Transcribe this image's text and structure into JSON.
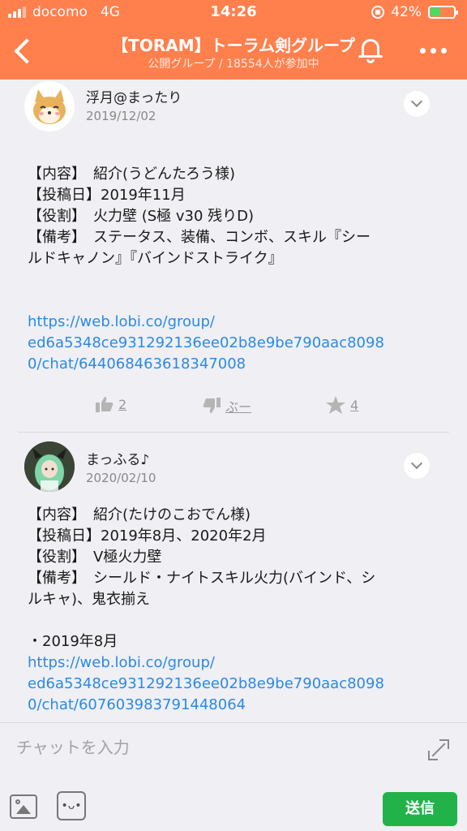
{
  "status_bar": {
    "carrier": "docomo",
    "network": "4G",
    "time": "14:26",
    "battery": "42%",
    "battery_level": 0.42
  },
  "header": {
    "title": "【TORAM】トーラム剣グループ",
    "subtitle": "公開グループ / 18554人が参加中",
    "icons": [
      "back-icon",
      "bell-icon",
      "more-icon"
    ]
  },
  "posts": [
    {
      "author": "浮月@まったり",
      "date": "2019/12/02",
      "lines": [
        "【内容】　紹介(うどんたろう様)",
        "【投稿日】2019年11月",
        "【役割】　火力壁 (S極 v30 残りD)",
        "【備考】　ステータス、装備、コンボ、スキル『シー",
        "ルドキャノン』『バインドストライク』"
      ],
      "link_lines": [
        "https://web.lobi.co/group/",
        "ed6a5348ce931292136ee02b8e9be790aac8098",
        "0/chat/644068463618347008"
      ],
      "likes": "2",
      "boo": "ぶー",
      "stars": "4"
    },
    {
      "author": "まっふる♪",
      "date": "2020/02/10",
      "lines": [
        "【内容】　紹介(たけのこおでん様)",
        "【投稿日】2019年8月、2020年2月",
        "【役割】　V極火力壁",
        "【備考】　シールド・ナイトスキル火力(バインド、シ",
        "ルキャ)、鬼衣揃え",
        "",
        "・2019年8月"
      ],
      "link_lines": [
        "https://web.lobi.co/group/",
        "ed6a5348ce931292136ee02b8e9be790aac8098",
        "0/chat/607603983791448064"
      ]
    }
  ],
  "composer": {
    "placeholder": "チャットを入力",
    "send_label": "送信",
    "stamp_glyph": "•ᴗ•"
  },
  "colors": {
    "header": "#ff7f4d",
    "link": "#2a8ae6",
    "send": "#21b34a"
  }
}
